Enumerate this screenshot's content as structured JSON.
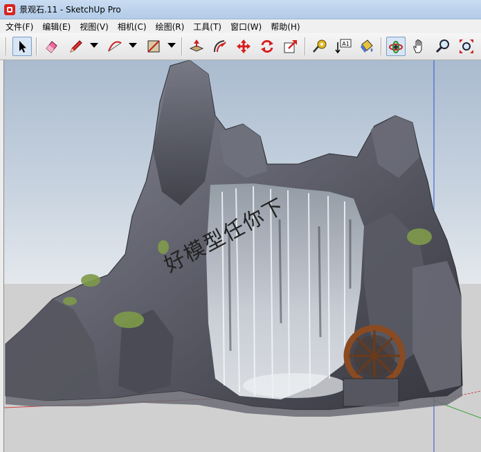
{
  "window": {
    "title": "景观石.11 - SketchUp Pro"
  },
  "menu": {
    "items": [
      "文件(F)",
      "编辑(E)",
      "视图(V)",
      "相机(C)",
      "绘图(R)",
      "工具(T)",
      "窗口(W)",
      "帮助(H)"
    ]
  },
  "toolbar": {
    "tools": [
      {
        "name": "select-tool",
        "icon": "arrow-cursor-icon",
        "pressed": false
      },
      {
        "name": "eraser-tool",
        "icon": "eraser-icon",
        "pressed": false
      },
      {
        "name": "line-tool",
        "icon": "pencil-icon",
        "pressed": false
      },
      {
        "name": "arc-tool",
        "icon": "arc-icon",
        "pressed": false
      },
      {
        "name": "rectangle-tool",
        "icon": "rectangle-icon",
        "pressed": false
      },
      {
        "name": "push-pull-tool",
        "icon": "push-pull-icon",
        "pressed": false
      },
      {
        "name": "offset-tool",
        "icon": "offset-icon",
        "pressed": false
      },
      {
        "name": "move-tool",
        "icon": "move-arrows-icon",
        "pressed": false
      },
      {
        "name": "rotate-tool",
        "icon": "rotate-icon",
        "pressed": false
      },
      {
        "name": "scale-tool",
        "icon": "scale-icon",
        "pressed": false
      },
      {
        "name": "tape-measure-tool",
        "icon": "tape-measure-icon",
        "pressed": false
      },
      {
        "name": "text-tool",
        "icon": "text-label-icon",
        "pressed": false
      },
      {
        "name": "paint-bucket-tool",
        "icon": "paint-bucket-icon",
        "pressed": false
      },
      {
        "name": "orbit-tool",
        "icon": "orbit-icon",
        "pressed": true
      },
      {
        "name": "pan-tool",
        "icon": "hand-icon",
        "pressed": false
      },
      {
        "name": "zoom-tool",
        "icon": "magnifier-icon",
        "pressed": false
      },
      {
        "name": "zoom-extents-tool",
        "icon": "zoom-extents-icon",
        "pressed": false
      }
    ],
    "text_tool_label": "A1"
  },
  "viewport": {
    "watermark": "好模型任你下",
    "colors": {
      "sky_top": "#aabbcf",
      "ground": "#d0d0d0",
      "axis_red": "#d04040",
      "axis_green": "#3aa03a",
      "axis_blue": "#3050d0",
      "rock": "#5e5f6a",
      "water": "#d8dee6",
      "moss": "#7f9a4a",
      "wheel": "#8a4a22"
    }
  }
}
